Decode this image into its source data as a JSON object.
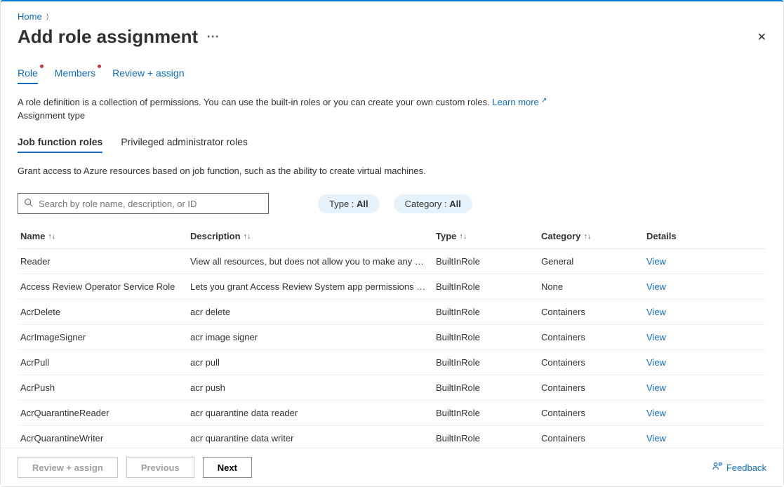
{
  "breadcrumb": {
    "home": "Home"
  },
  "title": "Add role assignment",
  "tabs": {
    "role": "Role",
    "members": "Members",
    "review": "Review + assign"
  },
  "intro": {
    "text": "A role definition is a collection of permissions. You can use the built-in roles or you can create your own custom roles. ",
    "learn_more": "Learn more",
    "assignment_type": "Assignment type"
  },
  "subtabs": {
    "job": "Job function roles",
    "priv": "Privileged administrator roles"
  },
  "subdesc": "Grant access to Azure resources based on job function, such as the ability to create virtual machines.",
  "search": {
    "placeholder": "Search by role name, description, or ID"
  },
  "filters": {
    "type_label": "Type : ",
    "type_value": "All",
    "cat_label": "Category : ",
    "cat_value": "All"
  },
  "columns": {
    "name": "Name",
    "desc": "Description",
    "type": "Type",
    "cat": "Category",
    "det": "Details"
  },
  "rows": [
    {
      "name": "Reader",
      "desc": "View all resources, but does not allow you to make any ch…",
      "type": "BuiltInRole",
      "cat": "General",
      "view": "View"
    },
    {
      "name": "Access Review Operator Service Role",
      "desc": "Lets you grant Access Review System app permissions to …",
      "type": "BuiltInRole",
      "cat": "None",
      "view": "View"
    },
    {
      "name": "AcrDelete",
      "desc": "acr delete",
      "type": "BuiltInRole",
      "cat": "Containers",
      "view": "View"
    },
    {
      "name": "AcrImageSigner",
      "desc": "acr image signer",
      "type": "BuiltInRole",
      "cat": "Containers",
      "view": "View"
    },
    {
      "name": "AcrPull",
      "desc": "acr pull",
      "type": "BuiltInRole",
      "cat": "Containers",
      "view": "View"
    },
    {
      "name": "AcrPush",
      "desc": "acr push",
      "type": "BuiltInRole",
      "cat": "Containers",
      "view": "View"
    },
    {
      "name": "AcrQuarantineReader",
      "desc": "acr quarantine data reader",
      "type": "BuiltInRole",
      "cat": "Containers",
      "view": "View"
    },
    {
      "name": "AcrQuarantineWriter",
      "desc": "acr quarantine data writer",
      "type": "BuiltInRole",
      "cat": "Containers",
      "view": "View"
    }
  ],
  "footer": {
    "review": "Review + assign",
    "previous": "Previous",
    "next": "Next",
    "feedback": "Feedback"
  }
}
